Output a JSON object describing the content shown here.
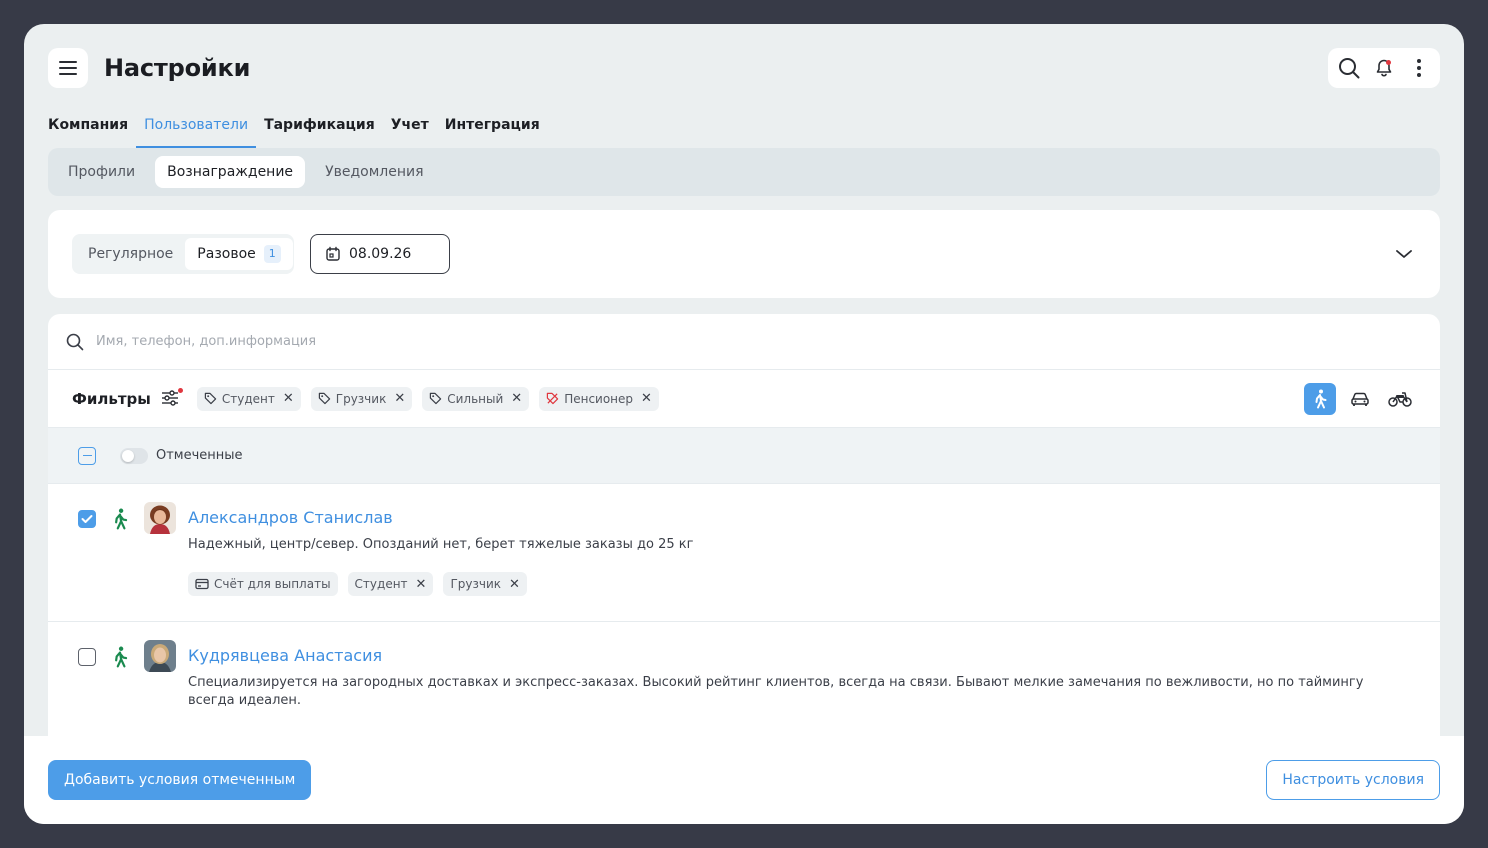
{
  "header": {
    "title": "Настройки"
  },
  "main_tabs": [
    {
      "label": "Компания",
      "active": false
    },
    {
      "label": "Пользователи",
      "active": true
    },
    {
      "label": "Тарификация",
      "active": false
    },
    {
      "label": "Учет",
      "active": false
    },
    {
      "label": "Интеграция",
      "active": false
    }
  ],
  "sub_tabs": [
    {
      "label": "Профили",
      "active": false
    },
    {
      "label": "Вознаграждение",
      "active": true
    },
    {
      "label": "Уведомления",
      "active": false
    }
  ],
  "reward_settings": {
    "segments": [
      {
        "label": "Регулярное",
        "active": false
      },
      {
        "label": "Разовое",
        "active": true,
        "badge": "1"
      }
    ],
    "date": "08.09.26"
  },
  "search": {
    "placeholder": "Имя, телефон, доп.информация"
  },
  "filters": {
    "label": "Фильтры",
    "chips": [
      {
        "label": "Студент",
        "icon": "tag-icon"
      },
      {
        "label": "Грузчик",
        "icon": "tag-icon"
      },
      {
        "label": "Сильный",
        "icon": "tag-icon"
      },
      {
        "label": "Пенсионер",
        "icon": "tag-off-icon"
      }
    ],
    "transport": [
      "walk-icon",
      "car-icon",
      "bike-icon"
    ]
  },
  "selection": {
    "toggle_label": "Отмеченные"
  },
  "users": [
    {
      "name": "Александров Станислав",
      "description": "Надежный, центр/север. Опозданий нет, берет тяжелые заказы до 25 кг",
      "checked": true,
      "tags": [
        {
          "label": "Счёт для выплаты",
          "icon": "card-icon",
          "removable": false
        },
        {
          "label": "Студент",
          "removable": true
        },
        {
          "label": "Грузчик",
          "removable": true
        }
      ]
    },
    {
      "name": "Кудрявцева Анастасия",
      "description": "Специализируется на загородных доставках и экспресс-заказах. Высокий рейтинг клиентов, всегда на связи. Бывают мелкие замечания по вежливости, но по таймингу всегда идеален.",
      "checked": false
    }
  ],
  "footer": {
    "primary_label": "Добавить условия отмеченным",
    "secondary_label": "Настроить условия"
  },
  "colors": {
    "accent": "#4d9de8",
    "courier_green": "#1a8a4f",
    "notification_red": "#e0373f"
  }
}
